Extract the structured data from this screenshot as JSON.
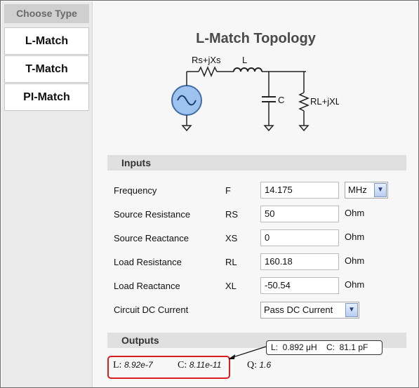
{
  "sidebar": {
    "heading": "Choose Type",
    "items": [
      {
        "label": "L-Match"
      },
      {
        "label": "T-Match"
      },
      {
        "label": "PI-Match"
      }
    ]
  },
  "topology": {
    "title": "L-Match Topology",
    "labels": {
      "source_impedance": "Rs+jXs",
      "inductor": "L",
      "capacitor": "C",
      "load_impedance": "RL+jXL"
    }
  },
  "inputs": {
    "heading": "Inputs",
    "rows": [
      {
        "label": "Frequency",
        "symbol": "F",
        "value": "14.175",
        "unit": "MHz"
      },
      {
        "label": "Source Resistance",
        "symbol": "RS",
        "value": "50",
        "unit": "Ohm"
      },
      {
        "label": "Source Reactance",
        "symbol": "XS",
        "value": "0",
        "unit": "Ohm"
      },
      {
        "label": "Load Resistance",
        "symbol": "RL",
        "value": "160.18",
        "unit": "Ohm"
      },
      {
        "label": "Load Reactance",
        "symbol": "XL",
        "value": "-50.54",
        "unit": "Ohm"
      }
    ],
    "dc_current": {
      "label": "Circuit DC Current",
      "value": "Pass DC Current"
    }
  },
  "outputs": {
    "heading": "Outputs",
    "L_label": "L:",
    "L_value": "8.92e-7",
    "C_label": "C:",
    "C_value": "8.11e-11",
    "Q_label": "Q:",
    "Q_value": "1.6",
    "callout": "L:  0.892 μH    C:  81.1 pF"
  },
  "colors": {
    "highlight": "#d81e1e",
    "source_fill": "#9ec3ee"
  }
}
